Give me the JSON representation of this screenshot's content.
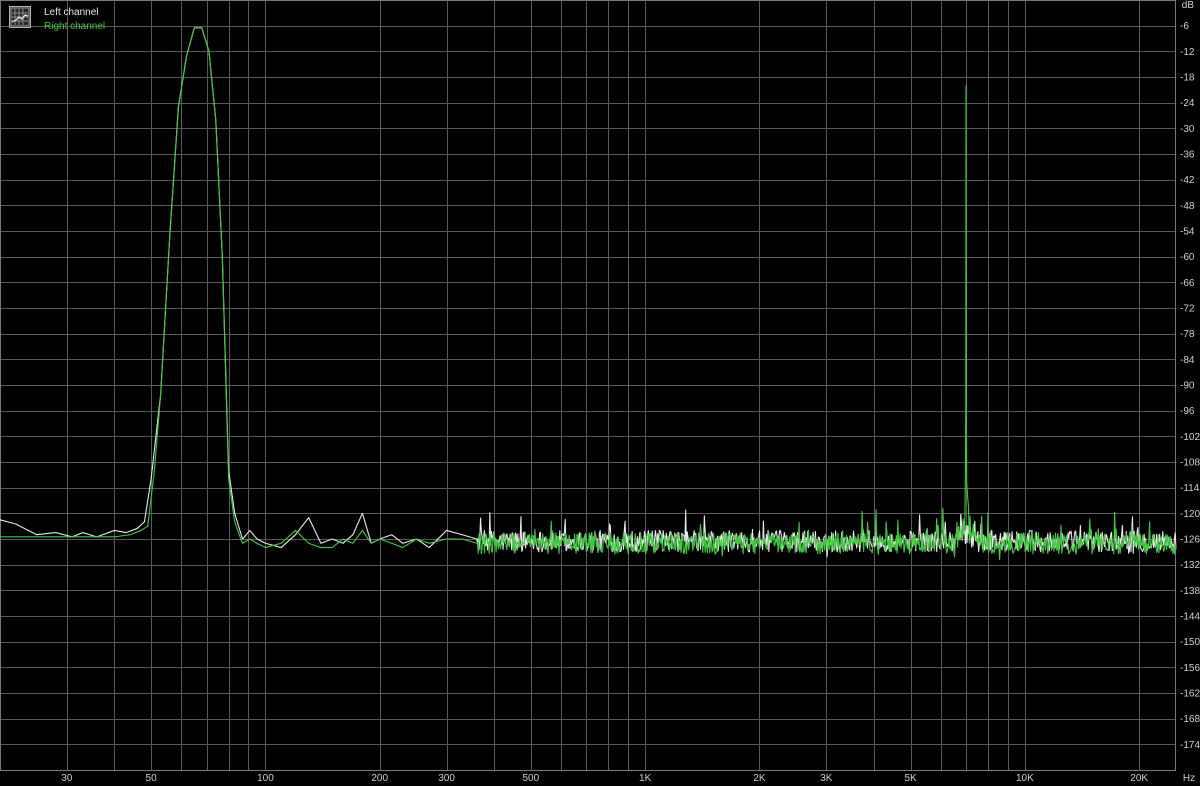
{
  "chart_data": {
    "type": "line",
    "title": "",
    "xlabel": "Hz",
    "ylabel": "dB",
    "x_scale": "log",
    "xlim": [
      20,
      25000
    ],
    "ylim": [
      -180,
      0
    ],
    "grid": true,
    "legend_placement": "top-left",
    "background": "#000000",
    "grid_color": "#5a5a5a",
    "x_tick_labels": [
      {
        "value": 30,
        "label": "30"
      },
      {
        "value": 50,
        "label": "50"
      },
      {
        "value": 100,
        "label": "100"
      },
      {
        "value": 200,
        "label": "200"
      },
      {
        "value": 300,
        "label": "300"
      },
      {
        "value": 500,
        "label": "500"
      },
      {
        "value": 1000,
        "label": "1K"
      },
      {
        "value": 2000,
        "label": "2K"
      },
      {
        "value": 3000,
        "label": "3K"
      },
      {
        "value": 5000,
        "label": "5K"
      },
      {
        "value": 10000,
        "label": "10K"
      },
      {
        "value": 20000,
        "label": "20K"
      }
    ],
    "x_grid_values": [
      30,
      40,
      50,
      60,
      70,
      80,
      90,
      100,
      200,
      300,
      400,
      500,
      600,
      700,
      800,
      900,
      1000,
      2000,
      3000,
      4000,
      5000,
      6000,
      7000,
      8000,
      9000,
      10000,
      20000
    ],
    "y_ticks": [
      -6,
      -12,
      -18,
      -24,
      -30,
      -36,
      -42,
      -48,
      -54,
      -60,
      -66,
      -72,
      -78,
      -84,
      -90,
      -96,
      -102,
      -108,
      -114,
      -120,
      -126,
      -132,
      -138,
      -144,
      -150,
      -156,
      -162,
      -168,
      -174
    ],
    "series": [
      {
        "name": "Left channel",
        "color": "#e8e8e8",
        "noise_floor": -126.5,
        "points": [
          [
            20,
            -121.5
          ],
          [
            22,
            -122.5
          ],
          [
            25,
            -125
          ],
          [
            28,
            -124.5
          ],
          [
            31,
            -125.5
          ],
          [
            33,
            -124.5
          ],
          [
            36,
            -125.5
          ],
          [
            40,
            -124
          ],
          [
            43,
            -124.5
          ],
          [
            46,
            -123.5
          ],
          [
            48,
            -122
          ],
          [
            50,
            -112
          ],
          [
            53,
            -92
          ],
          [
            56,
            -55
          ],
          [
            59,
            -25
          ],
          [
            62,
            -13
          ],
          [
            65,
            -6.5
          ],
          [
            68,
            -6.5
          ],
          [
            71,
            -12
          ],
          [
            74,
            -28
          ],
          [
            77,
            -60
          ],
          [
            80,
            -110
          ],
          [
            83,
            -120
          ],
          [
            87,
            -126
          ],
          [
            91,
            -124
          ],
          [
            95,
            -126
          ],
          [
            100,
            -127
          ],
          [
            110,
            -128
          ],
          [
            120,
            -125
          ],
          [
            130,
            -121
          ],
          [
            140,
            -127
          ],
          [
            150,
            -126
          ],
          [
            160,
            -127
          ],
          [
            170,
            -125
          ],
          [
            180,
            -120
          ],
          [
            190,
            -127
          ],
          [
            200,
            -126
          ],
          [
            215,
            -125
          ],
          [
            230,
            -127
          ],
          [
            250,
            -126
          ],
          [
            270,
            -128
          ],
          [
            300,
            -124
          ],
          [
            330,
            -125
          ],
          [
            360,
            -126
          ]
        ]
      },
      {
        "name": "Right channel",
        "color": "#41c841",
        "noise_floor": -127,
        "points": [
          [
            20,
            -125.5
          ],
          [
            25,
            -125.5
          ],
          [
            30,
            -125.5
          ],
          [
            35,
            -125.5
          ],
          [
            40,
            -125.5
          ],
          [
            44,
            -125
          ],
          [
            47,
            -124
          ],
          [
            49,
            -123
          ],
          [
            51,
            -110
          ],
          [
            53,
            -92
          ],
          [
            56,
            -55
          ],
          [
            59,
            -25
          ],
          [
            62,
            -13
          ],
          [
            65,
            -6.5
          ],
          [
            68,
            -6.5
          ],
          [
            71,
            -12
          ],
          [
            74,
            -28
          ],
          [
            77,
            -60
          ],
          [
            80,
            -112
          ],
          [
            83,
            -122
          ],
          [
            87,
            -127
          ],
          [
            91,
            -126
          ],
          [
            95,
            -127
          ],
          [
            100,
            -128
          ],
          [
            110,
            -127
          ],
          [
            120,
            -124
          ],
          [
            130,
            -127
          ],
          [
            140,
            -128
          ],
          [
            150,
            -128
          ],
          [
            160,
            -126
          ],
          [
            170,
            -127
          ],
          [
            180,
            -124
          ],
          [
            190,
            -127
          ],
          [
            200,
            -126
          ],
          [
            215,
            -127
          ],
          [
            230,
            -128
          ],
          [
            250,
            -126
          ],
          [
            270,
            -127
          ],
          [
            300,
            -126
          ],
          [
            330,
            -126
          ],
          [
            360,
            -127
          ]
        ],
        "peak": {
          "x": 7000,
          "y": -20
        }
      }
    ]
  }
}
